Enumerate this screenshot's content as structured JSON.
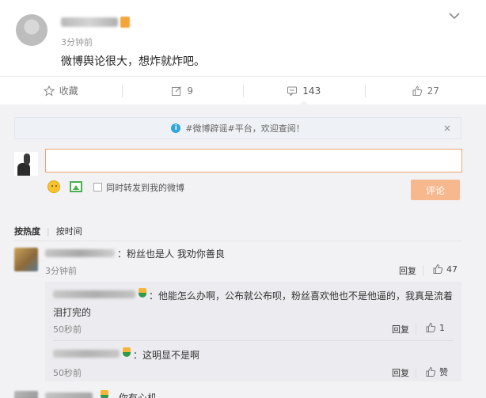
{
  "post": {
    "time": "3分钟前",
    "text": "微博舆论很大，想炸就炸吧。"
  },
  "actions": [
    {
      "icon": "star-icon",
      "label": "收藏"
    },
    {
      "icon": "edit-icon",
      "label": "9"
    },
    {
      "icon": "comment-icon",
      "label": "143"
    },
    {
      "icon": "thumbs-up-icon",
      "label": "27"
    }
  ],
  "notice": {
    "text": "#微博辟谣#平台，欢迎查阅！",
    "close": "×"
  },
  "composer": {
    "input_value": "",
    "repost_label": "同时转发到我的微博",
    "submit_label": "评论"
  },
  "sort": {
    "by_hot": "按热度",
    "separator": "|",
    "by_time": "按时间"
  },
  "comments": [
    {
      "text": "：粉丝也是人 我劝你善良",
      "time": "3分钟前",
      "reply": "回复",
      "likes": "47"
    }
  ],
  "replies": [
    {
      "text_line1": "：他能怎么办啊，公布就公布呗，粉丝喜欢他也不是他逼的，我真是流着",
      "text_line2": "泪打完的",
      "time": "50秒前",
      "reply": "回复",
      "likes": "1"
    },
    {
      "text": "：这明显不是啊",
      "time": "50秒前",
      "reply": "回复",
      "likes": "赞"
    }
  ],
  "cutoff_comment": {
    "text": "你有心机"
  },
  "colors": {
    "accent_orange": "#f7b88e",
    "panel_bg": "#f2f2f5",
    "info_blue": "#2fa6e0"
  }
}
